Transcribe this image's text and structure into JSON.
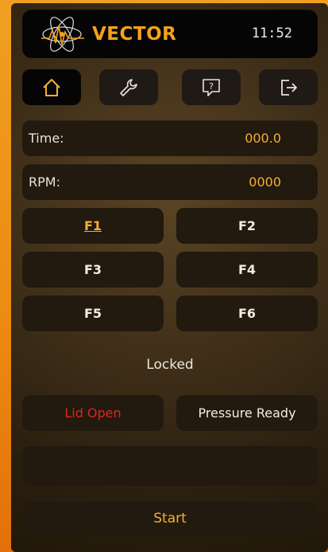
{
  "header": {
    "brand": "VECTOR",
    "clock": "11:52"
  },
  "nav": [
    {
      "icon": "home-icon",
      "active": true
    },
    {
      "icon": "wrench-icon",
      "active": false
    },
    {
      "icon": "help-icon",
      "active": false
    },
    {
      "icon": "logout-icon",
      "active": false
    }
  ],
  "readouts": {
    "time_label": "Time:",
    "time_value": "000.0",
    "rpm_label": "RPM:",
    "rpm_value": "0000"
  },
  "functions": {
    "f1": "F1",
    "f2": "F2",
    "f3": "F3",
    "f4": "F4",
    "f5": "F5",
    "f6": "F6",
    "selected": "F1"
  },
  "status": {
    "lock_state": "Locked",
    "lid": "Lid Open",
    "pressure": "Pressure Ready",
    "message": ""
  },
  "actions": {
    "start": "Start"
  },
  "colors": {
    "accent": "#f4b030",
    "brand": "#f4a21a",
    "alert": "#e0251e",
    "frame": "#ec8a10"
  }
}
